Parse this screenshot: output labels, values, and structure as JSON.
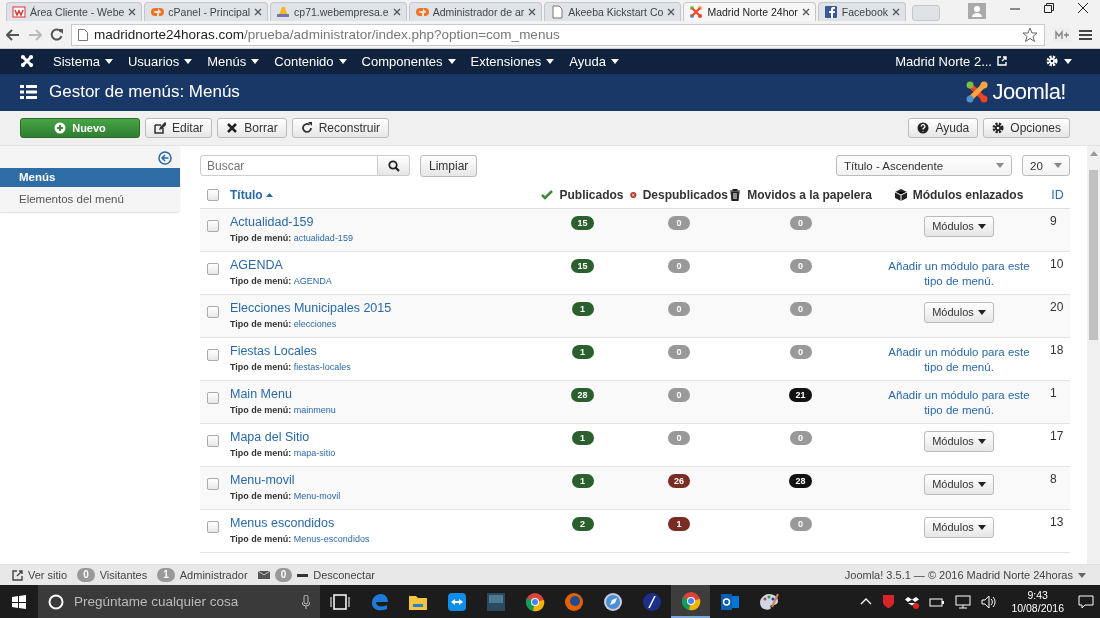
{
  "browser": {
    "tabs": [
      {
        "label": "Área Cliente - Webe",
        "kind": "webempresa",
        "selected": false
      },
      {
        "label": "cPanel - Principal",
        "kind": "cpanel",
        "selected": false
      },
      {
        "label": "cp71.webempresa.e",
        "kind": "pma",
        "selected": false
      },
      {
        "label": "Administrador de ar",
        "kind": "cpanel",
        "selected": false
      },
      {
        "label": "Akeeba Kickstart Co",
        "kind": "page",
        "selected": false
      },
      {
        "label": "Madrid Norte 24hor",
        "kind": "joomla",
        "selected": true
      },
      {
        "label": "Facebook",
        "kind": "facebook",
        "selected": false
      }
    ],
    "url_host": "madridnorte24horas.com",
    "url_path": "/prueba/administrator/index.php?option=com_menus"
  },
  "nav": {
    "menus": [
      "Sistema",
      "Usuarios",
      "Menús",
      "Contenido",
      "Componentes",
      "Extensiones",
      "Ayuda"
    ],
    "site": "Madrid Norte 2..."
  },
  "header": {
    "title": "Gestor de menús: Menús",
    "logo": "Joomla!"
  },
  "toolbar": {
    "left": [
      {
        "label": "Nuevo",
        "kind": "new"
      },
      {
        "label": "Editar",
        "kind": "edit"
      },
      {
        "label": "Borrar",
        "kind": "delete"
      },
      {
        "label": "Reconstruir",
        "kind": "rebuild"
      }
    ],
    "right": [
      {
        "label": "Ayuda",
        "kind": "help"
      },
      {
        "label": "Opciones",
        "kind": "options"
      }
    ]
  },
  "sidebar": {
    "items": [
      {
        "label": "Menús",
        "selected": true
      },
      {
        "label": "Elementos del menú",
        "selected": false
      }
    ]
  },
  "filters": {
    "search": {
      "placeholder": "Buscar"
    },
    "clear": "Limpiar",
    "sort": "Título - Ascendente",
    "limit": "20"
  },
  "table": {
    "select_all_checked": false,
    "columns": [
      {
        "label": "Título",
        "kind": "title"
      },
      {
        "label": "Publicados",
        "kind": "published"
      },
      {
        "label": "Despublicados",
        "kind": "unpublished"
      },
      {
        "label": "Movidos a la papelera",
        "kind": "trashed"
      },
      {
        "label": "Módulos enlazados",
        "kind": "modules"
      },
      {
        "label": "ID",
        "kind": "id"
      }
    ],
    "rows": [
      {
        "checked": false,
        "title": "Actualidad-159",
        "type_label": "Tipo de menú:",
        "menu_type": "actualidad-159",
        "published": "15",
        "unpublished": "0",
        "trashed": "0",
        "modules": {
          "kind": "button",
          "label": "Módulos"
        },
        "id": "9"
      },
      {
        "checked": false,
        "title": "AGENDA",
        "type_label": "Tipo de menú:",
        "menu_type": "AGENDA",
        "published": "15",
        "unpublished": "0",
        "trashed": "0",
        "modules": {
          "kind": "link",
          "label": "Añadir un módulo para este tipo de menú."
        },
        "id": "10"
      },
      {
        "checked": false,
        "title": "Elecciones Municipales 2015",
        "type_label": "Tipo de menú:",
        "menu_type": "elecciones",
        "published": "1",
        "unpublished": "0",
        "trashed": "0",
        "modules": {
          "kind": "button",
          "label": "Módulos"
        },
        "id": "20"
      },
      {
        "checked": false,
        "title": "Fiestas Locales",
        "type_label": "Tipo de menú:",
        "menu_type": "fiestas-locales",
        "published": "1",
        "unpublished": "0",
        "trashed": "0",
        "modules": {
          "kind": "link",
          "label": "Añadir un módulo para este tipo de menú."
        },
        "id": "18"
      },
      {
        "checked": false,
        "title": "Main Menu",
        "type_label": "Tipo de menú:",
        "menu_type": "mainmenu",
        "published": "28",
        "unpublished": "0",
        "trashed": "21",
        "modules": {
          "kind": "link",
          "label": "Añadir un módulo para este tipo de menú."
        },
        "id": "1"
      },
      {
        "checked": false,
        "title": "Mapa del Sitio",
        "type_label": "Tipo de menú:",
        "menu_type": "mapa-sitio",
        "published": "1",
        "unpublished": "0",
        "trashed": "0",
        "modules": {
          "kind": "button",
          "label": "Módulos"
        },
        "id": "17"
      },
      {
        "checked": false,
        "title": "Menu-movil",
        "type_label": "Tipo de menú:",
        "menu_type": "Menu-movil",
        "published": "1",
        "unpublished": "26",
        "trashed": "28",
        "modules": {
          "kind": "button",
          "label": "Módulos"
        },
        "id": "8"
      },
      {
        "checked": false,
        "title": "Menus escondidos",
        "type_label": "Tipo de menú:",
        "menu_type": "Menus-escondidos",
        "published": "2",
        "unpublished": "1",
        "trashed": "0",
        "modules": {
          "kind": "button",
          "label": "Módulos"
        },
        "id": "13"
      }
    ]
  },
  "status_bar": {
    "view_site": "Ver sitio",
    "visitors_count": "0",
    "visitors": "Visitantes",
    "admins_count": "1",
    "admins": "Administrador",
    "messages_count": "0",
    "logout": "Desconectar",
    "footer": "Joomla! 3.5.1  —  © 2016 Madrid Norte 24horas"
  },
  "taskbar": {
    "search": {
      "placeholder": "Pregúntame cualquier cosa"
    },
    "apps": [
      {
        "kind": "task-view",
        "selected": false
      },
      {
        "kind": "edge",
        "selected": false
      },
      {
        "kind": "explorer",
        "selected": false
      },
      {
        "kind": "teamviewer",
        "selected": false
      },
      {
        "kind": "audition",
        "selected": false
      },
      {
        "kind": "chrome",
        "selected": false
      },
      {
        "kind": "firefox",
        "selected": false
      },
      {
        "kind": "safari",
        "selected": false
      },
      {
        "kind": "blue-app",
        "selected": false
      },
      {
        "kind": "chrome",
        "selected": true
      },
      {
        "kind": "outlook",
        "selected": false
      },
      {
        "kind": "paint",
        "selected": false
      }
    ],
    "time": "9:43",
    "date": "10/08/2016"
  }
}
